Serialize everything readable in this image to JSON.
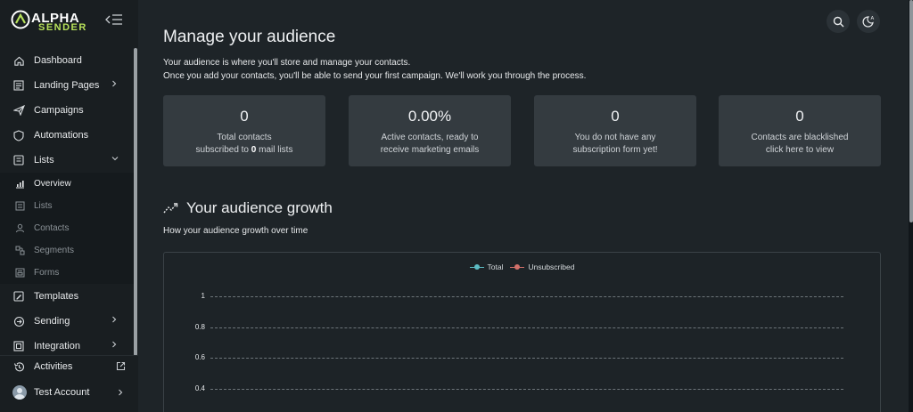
{
  "brand": {
    "line1": "ALPHA",
    "line2": "SENDER",
    "accent": "#b7e05a"
  },
  "sidebar": {
    "items": [
      {
        "label": "Dashboard",
        "icon": "home-icon"
      },
      {
        "label": "Landing Pages",
        "icon": "landing-pages-icon",
        "chevron": "right"
      },
      {
        "label": "Campaigns",
        "icon": "paper-plane-icon"
      },
      {
        "label": "Automations",
        "icon": "shield-icon"
      },
      {
        "label": "Lists",
        "icon": "lists-icon",
        "chevron": "down",
        "expanded": true
      }
    ],
    "subitems": [
      {
        "label": "Overview",
        "icon": "chart-icon",
        "active": true
      },
      {
        "label": "Lists",
        "icon": "list-icon"
      },
      {
        "label": "Contacts",
        "icon": "user-icon"
      },
      {
        "label": "Segments",
        "icon": "segments-icon"
      },
      {
        "label": "Forms",
        "icon": "forms-icon"
      }
    ],
    "items_after": [
      {
        "label": "Templates",
        "icon": "templates-icon"
      },
      {
        "label": "Sending",
        "icon": "sending-icon",
        "chevron": "right"
      },
      {
        "label": "Integration",
        "icon": "integration-icon",
        "chevron": "right"
      }
    ],
    "bottom": [
      {
        "label": "Activities",
        "icon": "history-icon",
        "trailing": "external-link-icon"
      },
      {
        "label": "Test Account",
        "icon": "avatar",
        "trailing": "chevron-right-icon"
      }
    ]
  },
  "header": {
    "search_icon": "search-icon",
    "theme_icon": "theme-toggle-icon"
  },
  "main": {
    "title": "Manage your audience",
    "intro_line1": "Your audience is where you'll store and manage your contacts.",
    "intro_line2": "Once you add your contacts, you'll be able to send your first campaign. We'll work you through the process.",
    "stats": [
      {
        "value": "0",
        "line1": "Total contacts",
        "line2_pre": "subscribed to ",
        "line2_bold": "0",
        "line2_post": " mail lists"
      },
      {
        "value": "0.00%",
        "line1": "Active contacts, ready to",
        "line2": "receive marketing emails"
      },
      {
        "value": "0",
        "line1": "You do not have any",
        "line2": "subscription form yet!"
      },
      {
        "value": "0",
        "line1": "Contacts are blacklished",
        "line2": "click here to view"
      }
    ],
    "growth_title": "Your audience growth",
    "growth_subtitle": "How your audience growth over time"
  },
  "chart_data": {
    "type": "line",
    "title": "",
    "xlabel": "",
    "ylabel": "",
    "legend_position": "top-center",
    "series": [
      {
        "name": "Total",
        "color": "#5cbcc4",
        "values": []
      },
      {
        "name": "Unsubscribed",
        "color": "#d2706a",
        "values": []
      }
    ],
    "y_ticks": [
      "1",
      "0.8",
      "0.6",
      "0.4"
    ],
    "ylim": [
      0,
      1
    ],
    "grid": true
  }
}
